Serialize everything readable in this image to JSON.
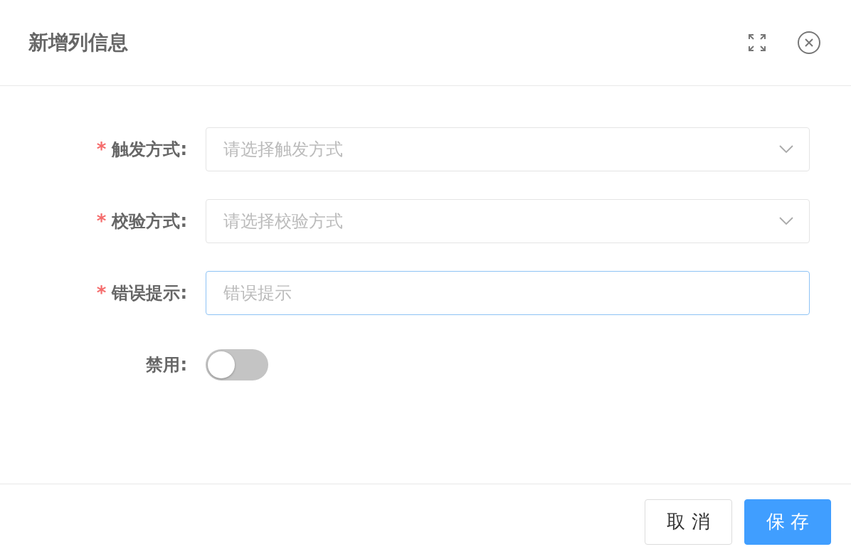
{
  "dialog": {
    "title": "新增列信息"
  },
  "fields": [
    {
      "kind": "select",
      "required_mark": "*",
      "label": "触发方式:",
      "placeholder": "请选择触发方式",
      "focused": false
    },
    {
      "kind": "select",
      "required_mark": "*",
      "label": "校验方式:",
      "placeholder": "请选择校验方式",
      "focused": false
    },
    {
      "kind": "input",
      "required_mark": "*",
      "label": "错误提示:",
      "placeholder": "错误提示",
      "focused": true
    },
    {
      "kind": "switch",
      "label": "禁用:",
      "on": false
    }
  ],
  "buttons": [
    {
      "label": "取 消",
      "kind": "default"
    },
    {
      "label": "保 存",
      "kind": "primary"
    }
  ]
}
